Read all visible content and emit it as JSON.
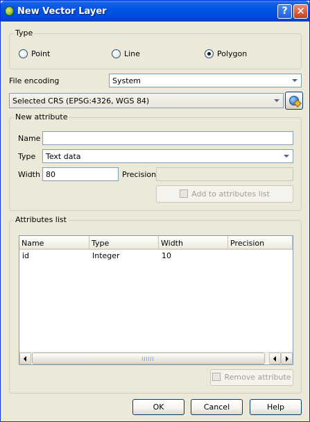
{
  "window": {
    "title": "New Vector Layer"
  },
  "type_group": {
    "legend": "Type",
    "options": [
      {
        "label": "Point",
        "checked": false
      },
      {
        "label": "Line",
        "checked": false
      },
      {
        "label": "Polygon",
        "checked": true
      }
    ]
  },
  "file_encoding": {
    "label": "File encoding",
    "value": "System"
  },
  "crs": {
    "value": "Selected CRS (EPSG:4326, WGS 84)"
  },
  "new_attribute": {
    "legend": "New attribute",
    "name_label": "Name",
    "name_value": "",
    "type_label": "Type",
    "type_value": "Text data",
    "width_label": "Width",
    "width_value": "80",
    "precision_label": "Precision",
    "precision_value": "",
    "add_button": "Add to attributes list"
  },
  "attributes_list": {
    "legend": "Attributes list",
    "columns": [
      "Name",
      "Type",
      "Width",
      "Precision"
    ],
    "rows": [
      [
        "id",
        "Integer",
        "10",
        ""
      ]
    ],
    "remove_button": "Remove attribute"
  },
  "buttons": {
    "ok": "OK",
    "cancel": "Cancel",
    "help": "Help"
  }
}
